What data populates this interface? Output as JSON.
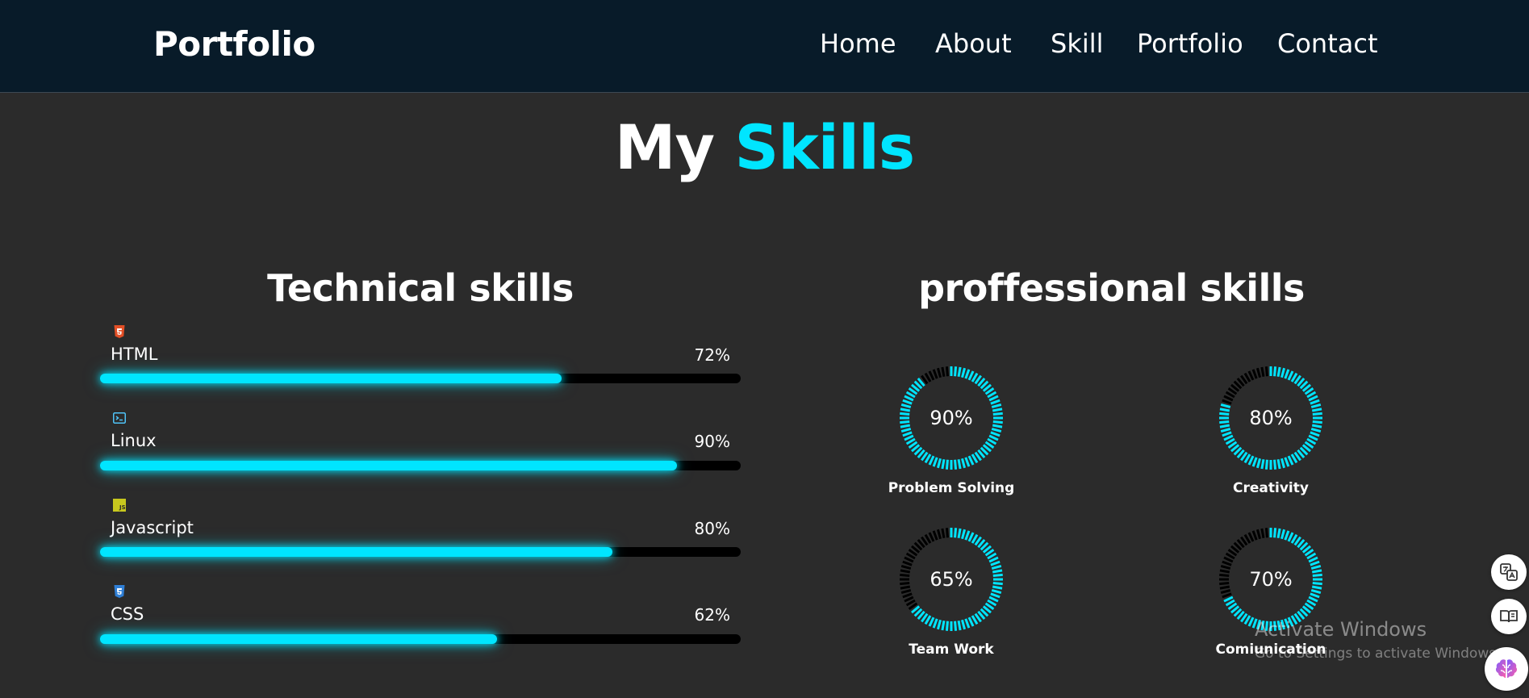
{
  "header": {
    "logo": "Portfolio",
    "nav": [
      "Home",
      "About",
      "Skill",
      "Portfolio",
      "Contact"
    ]
  },
  "section": {
    "title_plain": "My",
    "title_accent": "Skills"
  },
  "technical": {
    "title": "Technical skills",
    "skills": [
      {
        "name": "HTML",
        "percent_label": "72%",
        "percent": 72,
        "icon": "html5-icon",
        "icon_color": "#e34f26"
      },
      {
        "name": "Linux",
        "percent_label": "90%",
        "percent": 90,
        "icon": "terminal-icon",
        "icon_color": "#4fc3f7"
      },
      {
        "name": "Javascript",
        "percent_label": "80%",
        "percent": 80,
        "icon": "js-icon",
        "icon_color": "#c8c81e"
      },
      {
        "name": "CSS",
        "percent_label": "62%",
        "percent": 62,
        "icon": "css3-icon",
        "icon_color": "#2f7fd6"
      }
    ]
  },
  "professional": {
    "title": "proffessional skills",
    "skills": [
      {
        "name": "Problem Solving",
        "percent_label": "90%",
        "percent": 90
      },
      {
        "name": "Creativity",
        "percent_label": "80%",
        "percent": 80
      },
      {
        "name": "Team Work",
        "percent_label": "65%",
        "percent": 65
      },
      {
        "name": "Comiunication",
        "percent_label": "70%",
        "percent": 70
      }
    ]
  },
  "watermark": {
    "line1": "Activate Windows",
    "line2": "Go to Settings to activate Windows."
  },
  "colors": {
    "accent": "#00e5ff",
    "navbar": "#081b29",
    "background": "#2b2b2b",
    "track": "#000000"
  },
  "side_icons": [
    "translate-icon",
    "reader-icon",
    "brain-icon"
  ]
}
